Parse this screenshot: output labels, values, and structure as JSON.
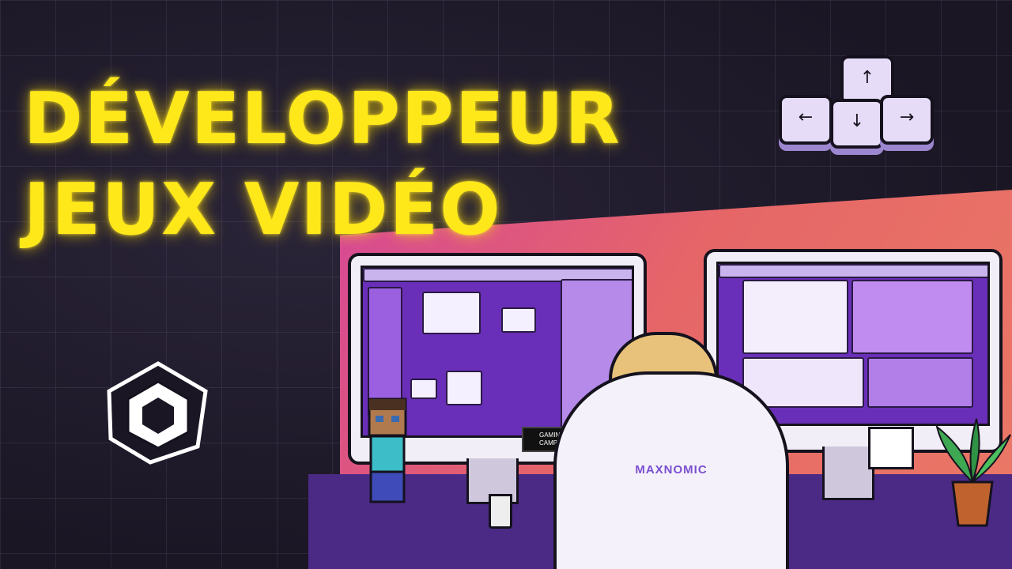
{
  "title": {
    "line1": "DÉVELOPPEUR",
    "line2": "JEUX VIDÉO"
  },
  "chair": {
    "brand": "MAXNOMIC"
  },
  "badge": {
    "text": "GAMING CAMPUS"
  },
  "keys": {
    "up": "↑",
    "left": "←",
    "down": "↓",
    "right": "→"
  },
  "colors": {
    "title": "#ffe81a",
    "accent": "#8a3fe0",
    "background": "#1b1726",
    "glow": "#f06a6a"
  }
}
